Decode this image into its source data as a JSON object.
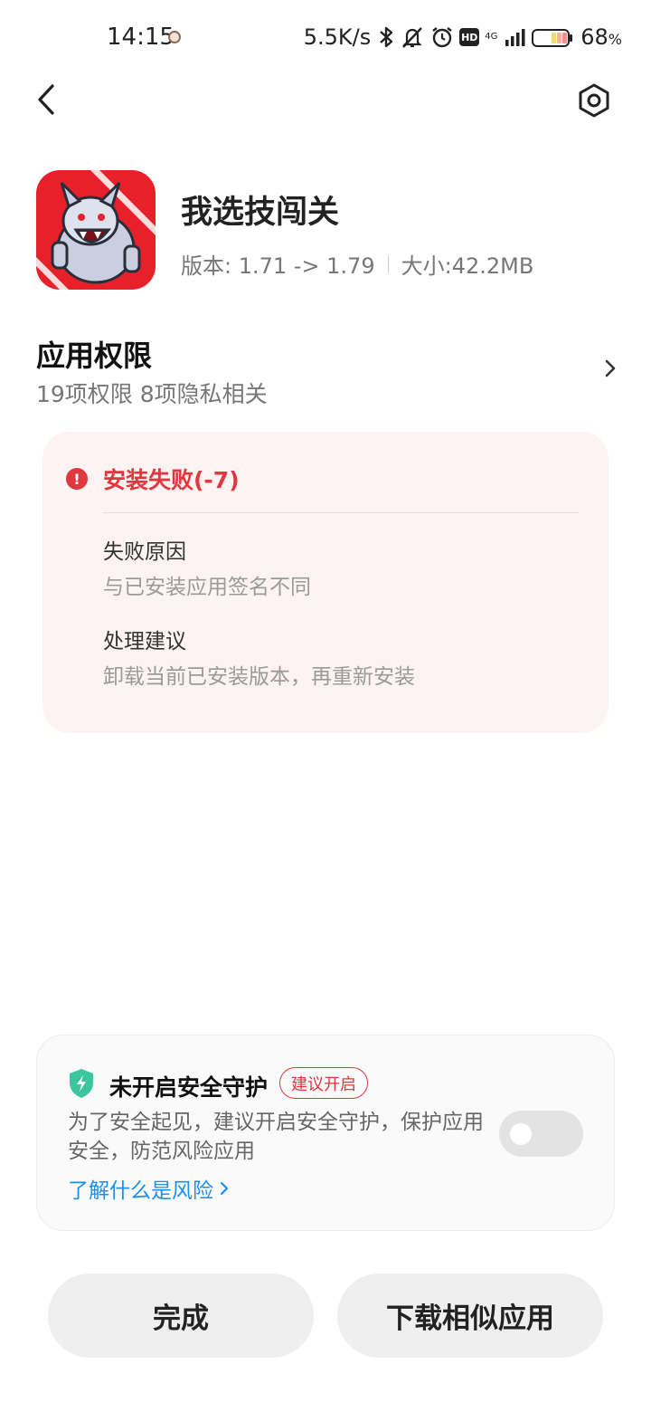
{
  "status_bar": {
    "time": "14:15",
    "net_speed": "5.5K/s",
    "network_type": "4G",
    "hd_label": "HD",
    "battery_percent": "68",
    "battery_unit": "%",
    "icons": [
      "face-icon",
      "bluetooth-icon",
      "mute-icon",
      "alarm-icon",
      "hd-icon",
      "signal-icon",
      "battery-icon"
    ]
  },
  "header": {
    "back_icon": "chevron-left-icon",
    "settings_icon": "settings-hexagon-icon"
  },
  "app": {
    "name": "我选技闯关",
    "version": "版本: 1.71 -> 1.79",
    "size": "大小:42.2MB",
    "icon_colors": {
      "background": "#e8202a",
      "creature": "#c9cfe0"
    }
  },
  "permissions": {
    "title": "应用权限",
    "summary": "19项权限 8项隐私相关"
  },
  "error": {
    "title": "安装失败(-7)",
    "reason_label": "失败原因",
    "reason_text": "与已安装应用签名不同",
    "suggestion_label": "处理建议",
    "suggestion_text": "卸载当前已安装版本，再重新安装",
    "color": "#e0383e"
  },
  "security": {
    "title": "未开启安全守护",
    "badge": "建议开启",
    "description": "为了安全起见，建议开启安全守护，保护应用安全，防范风险应用",
    "link": "了解什么是风险",
    "toggle_on": false,
    "shield_color": "#3cc6a0",
    "link_color": "#1d8ff0"
  },
  "buttons": {
    "done": "完成",
    "download_similar": "下载相似应用"
  }
}
